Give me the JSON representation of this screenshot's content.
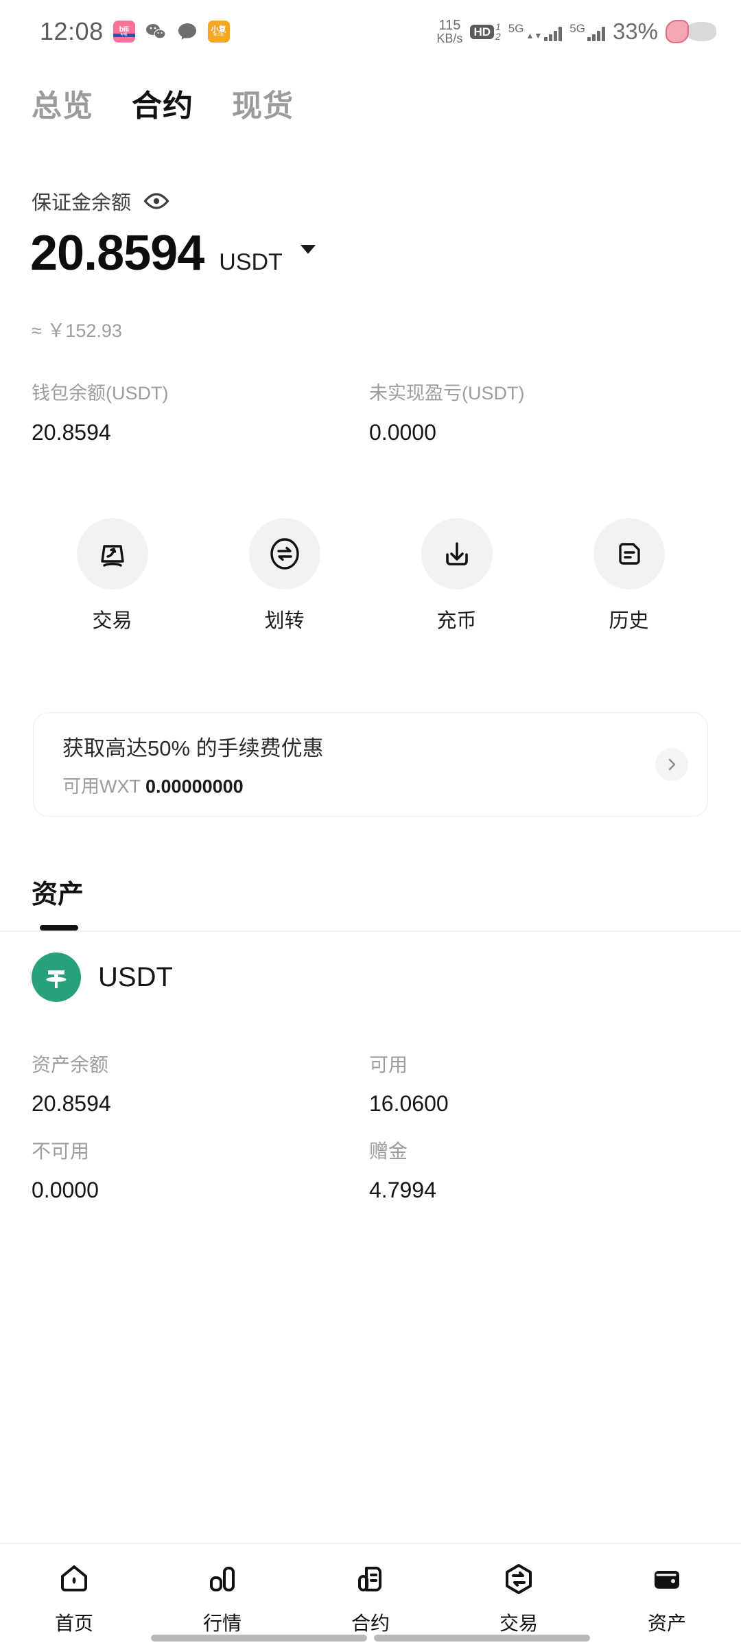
{
  "status_bar": {
    "time": "12:08",
    "app_icons": [
      {
        "name": "bilibili-icon",
        "top": "bilibili",
        "bottom": "哔哩哔哩"
      },
      {
        "name": "wechat-icon",
        "glyph": "●"
      },
      {
        "name": "chat-bubble-icon",
        "glyph": "●"
      },
      {
        "name": "xiaohongshu-icon",
        "top": "小复",
        "bottom": "第三名"
      }
    ],
    "network_speed_value": "115",
    "network_speed_unit": "KB/s",
    "hd_badge": "HD",
    "sim1": "1",
    "sim2": "2",
    "signal1_label": "5G",
    "signal2_label": "5G",
    "battery": "33%"
  },
  "top_tabs": [
    {
      "label": "总览",
      "active": false
    },
    {
      "label": "合约",
      "active": true
    },
    {
      "label": "现货",
      "active": false
    }
  ],
  "margin": {
    "label": "保证金余额",
    "eye_icon": "eye-icon",
    "amount": "20.8594",
    "unit": "USDT",
    "fiat_approx": "≈ ￥152.93"
  },
  "stats": [
    {
      "label": "钱包余额(USDT)",
      "value": "20.8594"
    },
    {
      "label": "未实现盈亏(USDT)",
      "value": "0.0000"
    }
  ],
  "actions": [
    {
      "label": "交易",
      "icon": "trade-icon"
    },
    {
      "label": "划转",
      "icon": "transfer-icon"
    },
    {
      "label": "充币",
      "icon": "deposit-icon"
    },
    {
      "label": "历史",
      "icon": "history-icon"
    }
  ],
  "promo": {
    "title": "获取高达50% 的手续费优惠",
    "sub_label": "可用WXT",
    "sub_value": "0.00000000",
    "chevron_icon": "chevron-right-icon"
  },
  "assets": {
    "section_title": "资产",
    "coin": {
      "symbol": "USDT",
      "logo_color": "#26A17B",
      "fields": [
        {
          "label": "资产余额",
          "value": "20.8594"
        },
        {
          "label": "可用",
          "value": "16.0600"
        },
        {
          "label": "不可用",
          "value": "0.0000"
        },
        {
          "label": "赠金",
          "value": "4.7994"
        }
      ]
    }
  },
  "bottom_nav": [
    {
      "label": "首页",
      "icon": "home-icon",
      "active": false
    },
    {
      "label": "行情",
      "icon": "markets-icon",
      "active": false
    },
    {
      "label": "合约",
      "icon": "futures-icon",
      "active": false
    },
    {
      "label": "交易",
      "icon": "trade-hex-icon",
      "active": false
    },
    {
      "label": "资产",
      "icon": "wallet-icon",
      "active": true
    }
  ]
}
